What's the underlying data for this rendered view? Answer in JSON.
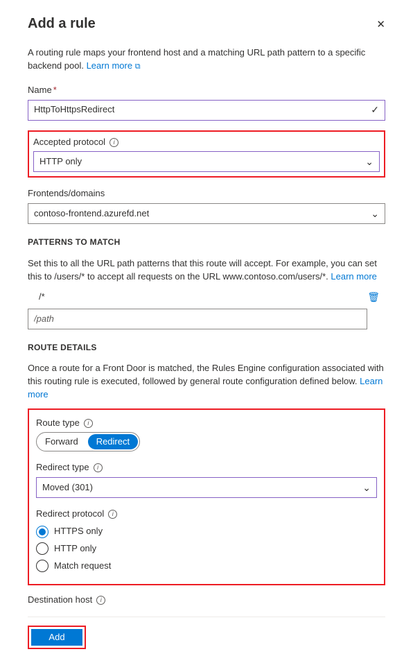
{
  "header": {
    "title": "Add a rule"
  },
  "description": {
    "text": "A routing rule maps your frontend host and a matching URL path pattern to a specific backend pool.",
    "learn_more": "Learn more"
  },
  "name_field": {
    "label": "Name",
    "value": "HttpToHttpsRedirect"
  },
  "protocol_field": {
    "label": "Accepted protocol",
    "value": "HTTP only"
  },
  "frontends_field": {
    "label": "Frontends/domains",
    "value": "contoso-frontend.azurefd.net"
  },
  "patterns": {
    "heading": "Patterns to match",
    "description_a": "Set this to all the URL path patterns that this route will accept. For example, you can set this to /users/* to accept all requests on the URL www.contoso.com/users/*.",
    "learn_more": "Learn more",
    "existing": "/*",
    "placeholder": "/path"
  },
  "route": {
    "heading": "Route Details",
    "description": "Once a route for a Front Door is matched, the Rules Engine configuration associated with this routing rule is executed, followed by general route configuration defined below.",
    "learn_more": "Learn more",
    "type_label": "Route type",
    "forward": "Forward",
    "redirect": "Redirect",
    "redirect_type_label": "Redirect type",
    "redirect_type_value": "Moved (301)",
    "redirect_protocol_label": "Redirect protocol",
    "opt_https": "HTTPS only",
    "opt_http": "HTTP only",
    "opt_match": "Match request"
  },
  "dest_host": {
    "label": "Destination host"
  },
  "footer": {
    "add": "Add"
  }
}
